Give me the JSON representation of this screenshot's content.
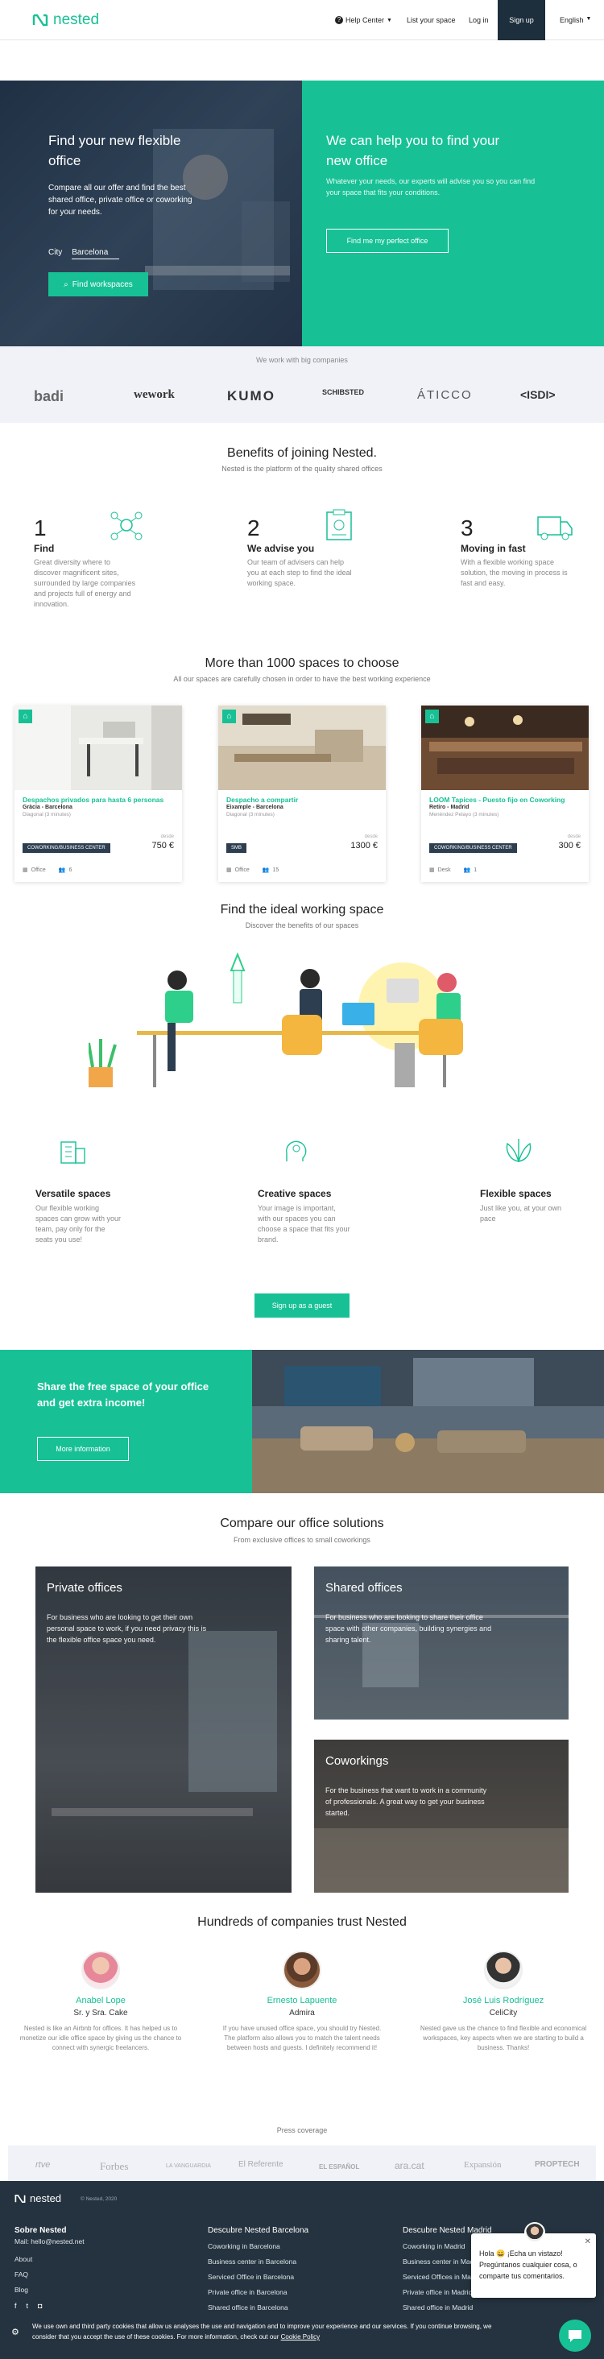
{
  "header": {
    "brand": "nested",
    "help_center": "Help Center",
    "list_space": "List your space",
    "login": "Log in",
    "signup": "Sign up",
    "language": "English"
  },
  "hero": {
    "left_title": "Find your new flexible office",
    "left_text": "Compare all our offer and find the best shared office, private office or coworking for your needs.",
    "city_label": "City",
    "city_value": "Barcelona",
    "find_button": "Find workspaces",
    "right_title": "We can help you to find your new office",
    "right_text": "Whatever your needs, our experts will advise you so you can find your space that fits your conditions.",
    "right_button": "Find me my perfect office"
  },
  "partners": {
    "heading": "We work with big companies",
    "logos": [
      "badi",
      "wework",
      "KUMO",
      "SCHIBSTED",
      "ÁTICCO",
      "<ISDI>"
    ]
  },
  "benefits": {
    "title": "Benefits of joining Nested.",
    "subtitle": "Nested is the platform of the quality shared offices",
    "steps": [
      {
        "num": "1",
        "title": "Find",
        "text": "Great diversity where to discover magnificent sites, surrounded by large companies and projects full of energy and innovation."
      },
      {
        "num": "2",
        "title": "We advise you",
        "text": "Our team of advisers can help you at each step to find the ideal working space."
      },
      {
        "num": "3",
        "title": "Moving in fast",
        "text": "With a flexible working space solution, the moving in process is fast and easy."
      }
    ]
  },
  "spaces": {
    "title": "More than 1000 spaces to choose",
    "subtitle": "All our spaces are carefully chosen in order to have the best working experience",
    "cards": [
      {
        "title": "Despachos privados para hasta 6 personas",
        "location": "Gràcia - Barcelona",
        "metro": "Diagonal (3 minutes)",
        "from": "desde",
        "price": "750 €",
        "badge": "COWORKING/BUSINESS CENTER",
        "kind": "Office",
        "people": "6"
      },
      {
        "title": "Despacho a compartir",
        "location": "Eixample - Barcelona",
        "metro": "Diagonal (3 minutes)",
        "from": "desde",
        "price": "1300 €",
        "badge": "SMB",
        "kind": "Office",
        "people": "15"
      },
      {
        "title": "LOOM Tapices - Puesto fijo en Coworking",
        "location": "Retiro - Madrid",
        "metro": "Menéndez Pelayo (3 minutes)",
        "from": "desde",
        "price": "300 €",
        "badge": "COWORKING/BUSINESS CENTER",
        "kind": "Desk",
        "people": "1"
      }
    ]
  },
  "ideal": {
    "title": "Find the ideal working space",
    "subtitle": "Discover the benefits of our spaces",
    "items": [
      {
        "title": "Versatile spaces",
        "text": "Our flexible working spaces can grow with your team, pay only for the seats you use!"
      },
      {
        "title": "Creative spaces",
        "text": "Your image is important, with our spaces you can choose a space that fits your brand."
      },
      {
        "title": "Flexible spaces",
        "text": "Just like you, at your own pace"
      }
    ],
    "guest_button": "Sign up as a guest"
  },
  "share": {
    "title": "Share the free space of your office and get extra income!",
    "button": "More information"
  },
  "compare": {
    "title": "Compare our office solutions",
    "subtitle": "From exclusive offices to small coworkings",
    "offices": [
      {
        "title": "Private offices",
        "text": "For business who are looking to get their own personal space to work, if you need privacy this is the flexible office space you need."
      },
      {
        "title": "Shared offices",
        "text": "For business who are looking to share their office space with other companies, building synergies and sharing talent."
      },
      {
        "title": "Coworkings",
        "text": "For the business that want to work in a community of professionals. A great way to get your business started."
      }
    ]
  },
  "trust": {
    "title": "Hundreds of companies trust Nested",
    "testimonials": [
      {
        "name": "Anabel Lope",
        "company": "Sr. y Sra. Cake",
        "text": "Nested is like an Airbnb for offices. It has helped us to monetize our idle office space by giving us the chance to connect with synergic freelancers."
      },
      {
        "name": "Ernesto Lapuente",
        "company": "Admira",
        "text": "If you have unused office space, you should try Nested. The platform also allows you to match the talent needs between hosts and guests. I definitely recommend it!"
      },
      {
        "name": "José Luis Rodríguez",
        "company": "CeliCity",
        "text": "Nested gave us the chance to find flexible and economical workspaces, key aspects when we are starting to build a business. Thanks!"
      }
    ]
  },
  "press": {
    "title": "Press coverage",
    "logos": [
      "rtve",
      "Forbes",
      "LA VANGUARDIA",
      "El Referente",
      "EL ESPAÑOL",
      "ara.cat",
      "Expansión",
      "PROPTECH"
    ]
  },
  "footer": {
    "brand": "nested",
    "copyright": "© Nested, 2020",
    "about_title": "Sobre Nested",
    "mail": "Mail: hello@nested.net",
    "links": [
      "About",
      "FAQ",
      "Blog"
    ],
    "bcn_title": "Descubre Nested Barcelona",
    "bcn_links": [
      "Coworking in Barcelona",
      "Business center in Barcelona",
      "Serviced Office in Barcelona",
      "Private office in Barcelona",
      "Shared office in Barcelona"
    ],
    "mad_title": "Descubre Nested Madrid",
    "mad_links": [
      "Coworking in Madrid",
      "Business center in Madrid",
      "Serviced Offices in Madrid",
      "Private office in Madrid",
      "Shared office in Madrid"
    ]
  },
  "cookie": {
    "text": "We use own and third party cookies that allow us analyses the use and navigation and to improve your experience and our services. If you continue browsing, we consider that you accept the use of these cookies. For more information, check out our",
    "link": "Cookie Policy"
  },
  "chat": {
    "message": "Hola 😀 ¡Echa un vistazo! Pregúntanos cualquier cosa, o comparte tus comentarios."
  },
  "colors": {
    "accent": "#17c195",
    "dark": "#24333f",
    "signup": "#1d2e3c"
  }
}
